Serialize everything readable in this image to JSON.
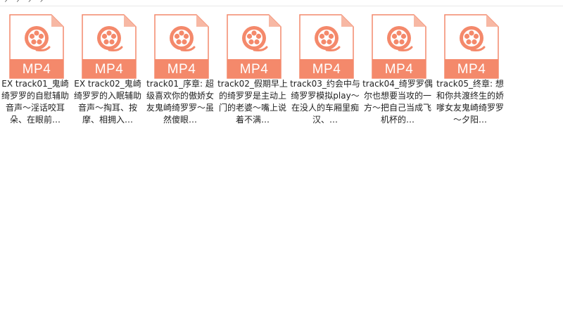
{
  "breadcrumb": {
    "items": [
      "",
      "",
      "",
      "",
      ""
    ]
  },
  "file_type_label": "MP4",
  "colors": {
    "icon_body": "#f4896b",
    "icon_fold": "#f7b8a4",
    "icon_band": "#ee7c5c",
    "icon_text": "#ffffff"
  },
  "files": [
    {
      "name": "EX track01_鬼崎绮罗罗的自慰辅助音声～淫话咬耳朵、在眼前…",
      "icon": "video-reel-icon"
    },
    {
      "name": "EX track02_鬼崎绮罗罗的入眠辅助音声～掏耳、按摩、相拥入…",
      "icon": "video-reel-icon"
    },
    {
      "name": "track01_序章: 超级喜欢你的傲娇女友鬼崎绮罗罗～虽然傻眼…",
      "icon": "video-reel-icon"
    },
    {
      "name": "track02_假期早上的绮罗罗是主动上门的老婆～嘴上说着不满…",
      "icon": "video-reel-icon"
    },
    {
      "name": "track03_约会中与绮罗罗模拟play～在没人的车厢里痴汉、…",
      "icon": "video-reel-icon"
    },
    {
      "name": "track04_绮罗罗偶尔也想要当攻的一方～把自己当成飞机杯的…",
      "icon": "video-reel-icon"
    },
    {
      "name": "track05_终章: 想和你共渡终生的娇嗲女友鬼崎绮罗罗～夕阳…",
      "icon": "video-reel-icon"
    }
  ]
}
